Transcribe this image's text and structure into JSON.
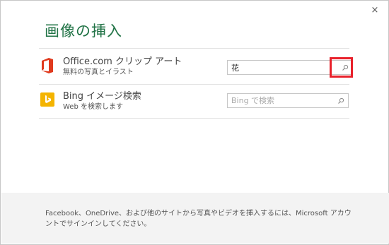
{
  "dialog": {
    "title": "画像の挿入",
    "close_label": "×"
  },
  "sources": [
    {
      "name": "Office.com クリップ アート",
      "subtitle": "無料の写真とイラスト",
      "search_value": "花",
      "search_placeholder": "",
      "icon": "office-logo-icon",
      "icon_color": "#e03a1e"
    },
    {
      "name": "Bing イメージ検索",
      "subtitle": "Web を検索します",
      "search_value": "",
      "search_placeholder": "Bing で検索",
      "icon": "bing-logo-icon",
      "icon_color": "#f4b400"
    }
  ],
  "footer": {
    "text": "Facebook、OneDrive、および他のサイトから写真やビデオを挿入するには、Microsoft アカウントでサインインしてください。"
  },
  "colors": {
    "title": "#217346",
    "highlight": "#e8212b"
  }
}
